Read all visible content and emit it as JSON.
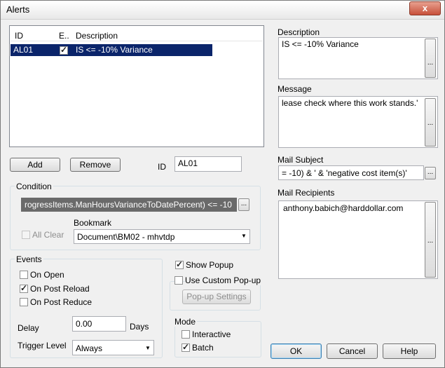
{
  "window": {
    "title": "Alerts",
    "close_glyph": "x"
  },
  "alerts_table": {
    "columns": [
      "ID",
      "E..",
      "Description"
    ],
    "rows": [
      {
        "id": "AL01",
        "enabled": true,
        "description": "IS <= -10% Variance"
      }
    ]
  },
  "buttons": {
    "add": "Add",
    "remove": "Remove",
    "ok": "OK",
    "cancel": "Cancel",
    "help": "Help",
    "popup_settings": "Pop-up Settings",
    "ellipsis": "..."
  },
  "id_field": {
    "label": "ID",
    "value": "AL01"
  },
  "condition": {
    "label": "Condition",
    "expression": "rogressItems.ManHoursVarianceToDatePercent) <= -10",
    "all_clear_label": "All Clear",
    "bookmark_label": "Bookmark",
    "bookmark_value": "Document\\BM02 - mhvtdp"
  },
  "events": {
    "label": "Events",
    "on_open": "On Open",
    "on_post_reload": "On Post Reload",
    "on_post_reduce": "On Post Reduce",
    "delay_label": "Delay",
    "delay_value": "0.00",
    "days_label": "Days",
    "trigger_label": "Trigger Level",
    "trigger_value": "Always"
  },
  "popup": {
    "show_popup": "Show Popup",
    "use_custom": "Use Custom Pop-up"
  },
  "mode": {
    "label": "Mode",
    "interactive": "Interactive",
    "batch": "Batch"
  },
  "right": {
    "description_label": "Description",
    "description_value": "IS <= -10% Variance",
    "message_label": "Message",
    "message_value": "lease check where this work stands.'",
    "mail_subject_label": "Mail Subject",
    "mail_subject_value": "= -10) & ' & 'negative cost item(s)'",
    "mail_recipients_label": "Mail Recipients",
    "mail_recipients_value": "anthony.babich@harddollar.com"
  }
}
